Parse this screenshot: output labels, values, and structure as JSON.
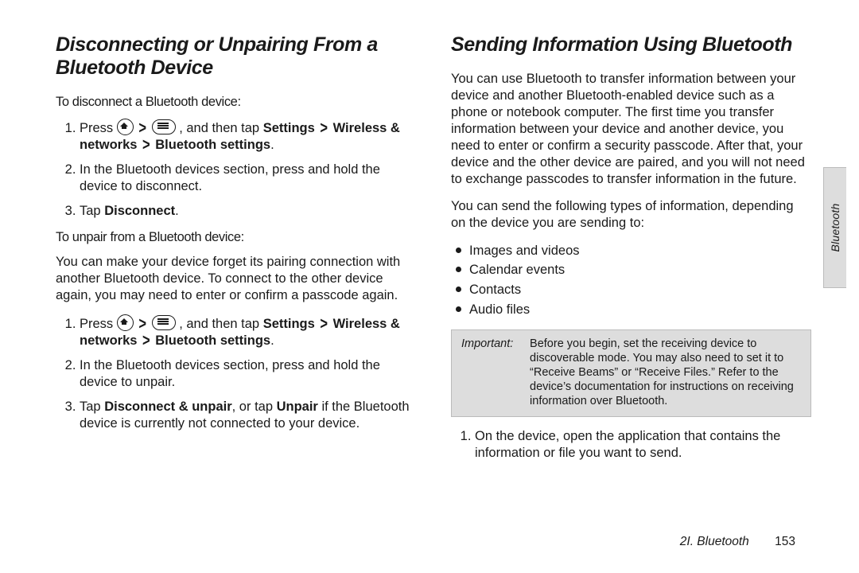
{
  "left": {
    "heading": "Disconnecting or Unpairing From a Bluetooth Device",
    "sub1": "To disconnect a Bluetooth device:",
    "s1_li1_a": "Press ",
    "s1_li1_b": ", and then tap ",
    "s1_li1_set": "Settings",
    "s1_li1_net": "Wireless & networks",
    "s1_li1_bt": "Bluetooth settings",
    "s1_li2": "In the Bluetooth devices section, press and hold the device to disconnect.",
    "s1_li3_a": "Tap ",
    "s1_li3_b": "Disconnect",
    "sub2": "To unpair from a Bluetooth device:",
    "para": "You can make your device forget its pairing connection with another Bluetooth device. To connect to the other device again, you may need to enter or confirm a passcode again.",
    "s2_li2": "In the Bluetooth devices section, press and hold the device to unpair.",
    "s2_li3_a": "Tap ",
    "s2_li3_b": "Disconnect & unpair",
    "s2_li3_c": ", or tap ",
    "s2_li3_d": "Unpair",
    "s2_li3_e": " if the Bluetooth device is currently not connected to your device."
  },
  "right": {
    "heading": "Sending Information Using Bluetooth",
    "p1": "You can use Bluetooth to transfer information between your device and another Bluetooth-enabled device such as a phone or notebook computer. The first time you transfer information between your device and another device, you need to enter or confirm a security passcode. After that, your device and the other device are paired, and you will not need to exchange passcodes to transfer information in the future.",
    "p2": "You can send the following types of information, depending on the device you are sending to:",
    "b1": "Images and videos",
    "b2": "Calendar events",
    "b3": "Contacts",
    "b4": "Audio files",
    "note_hdr": "Important:",
    "note_body": "Before you begin, set the receiving device to discoverable mode. You may also need to set it to “Receive Beams” or “Receive Files.” Refer to the device’s documentation for instructions on receiving information over Bluetooth.",
    "s_li1": "On the device, open the application that contains the information or file you want to send."
  },
  "tab": "Bluetooth",
  "footer_section": "2I. Bluetooth",
  "footer_page": "153",
  "period": "."
}
